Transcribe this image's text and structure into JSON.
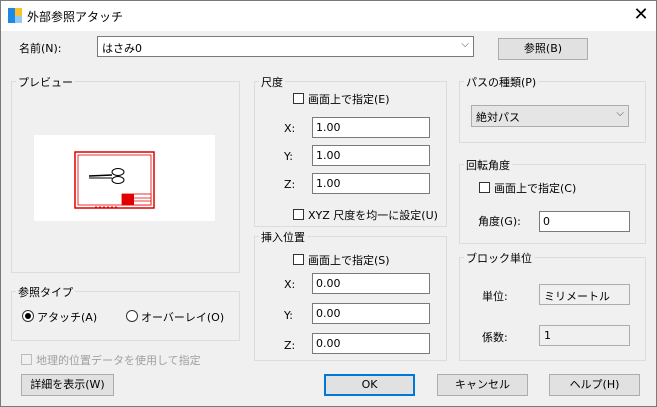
{
  "window": {
    "title": "外部参照アタッチ",
    "close_glyph": "✕"
  },
  "name": {
    "label": "名前(N):",
    "value": "はさみ0",
    "browse_label": "参照(B)"
  },
  "preview": {
    "label": "プレビュー"
  },
  "scale": {
    "label": "尺度",
    "specify_on_screen": "画面上で指定(E)",
    "x_label": "X:",
    "x_value": "1.00",
    "y_label": "Y:",
    "y_value": "1.00",
    "z_label": "Z:",
    "z_value": "1.00",
    "uniform": "XYZ 尺度を均一に設定(U)"
  },
  "insertion": {
    "label": "挿入位置",
    "specify_on_screen": "画面上で指定(S)",
    "x_label": "X:",
    "x_value": "0.00",
    "y_label": "Y:",
    "y_value": "0.00",
    "z_label": "Z:",
    "z_value": "0.00"
  },
  "path_type": {
    "label": "パスの種類(P)",
    "value": "絶対パス"
  },
  "rotation": {
    "label": "回転角度",
    "specify_on_screen": "画面上で指定(C)",
    "angle_label": "角度(G):",
    "angle_value": "0"
  },
  "block_unit": {
    "label": "ブロック単位",
    "unit_label": "単位:",
    "unit_value": "ミリメートル",
    "factor_label": "係数:",
    "factor_value": "1"
  },
  "reference_type": {
    "label": "参照タイプ",
    "attach": "アタッチ(A)",
    "overlay": "オーバーレイ(O)"
  },
  "geo": {
    "label": "地理的位置データを使用して指定"
  },
  "buttons": {
    "details": "詳細を表示(W)",
    "ok": "OK",
    "cancel": "キャンセル",
    "help": "ヘルプ(H)"
  },
  "colors": {
    "accent": "#0078d7",
    "preview_red": "#e00000"
  }
}
